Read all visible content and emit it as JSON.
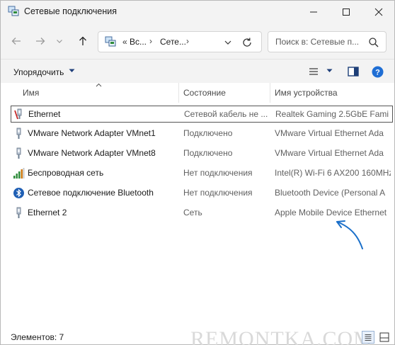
{
  "window": {
    "title": "Сетевые подключения"
  },
  "address_bar": {
    "overflow": "«",
    "crumbs": [
      "Вс...",
      "Сете..."
    ],
    "separator": "›"
  },
  "search": {
    "placeholder": "Поиск в: Сетевые п..."
  },
  "toolbar": {
    "organize_label": "Упорядочить"
  },
  "columns": {
    "name": "Имя",
    "status": "Состояние",
    "device": "Имя устройства"
  },
  "connections": [
    {
      "name": "Ethernet",
      "status": "Сетевой кабель не ...",
      "device": "Realtek Gaming 2.5GbE Fami",
      "icon": "ethernet-disconnected-icon"
    },
    {
      "name": "VMware Network Adapter VMnet1",
      "status": "Подключено",
      "device": "VMware Virtual Ethernet Ada",
      "icon": "ethernet-icon"
    },
    {
      "name": "VMware Network Adapter VMnet8",
      "status": "Подключено",
      "device": "VMware Virtual Ethernet Ada",
      "icon": "ethernet-icon"
    },
    {
      "name": "Беспроводная сеть",
      "status": "Нет подключения",
      "device": "Intel(R) Wi-Fi 6 AX200 160MHz",
      "icon": "wifi-signal-icon"
    },
    {
      "name": "Сетевое подключение Bluetooth",
      "status": "Нет подключения",
      "device": "Bluetooth Device (Personal A",
      "icon": "bluetooth-icon"
    },
    {
      "name": "Ethernet 2",
      "status": "Сеть",
      "device": "Apple Mobile Device Ethernet",
      "icon": "ethernet-icon"
    }
  ],
  "statusbar": {
    "count": "Элементов: 7",
    "watermark": "REMONTKA.COM"
  },
  "colors": {
    "accent": "#0067c0",
    "annotation_arrow": "#1a6fc9"
  }
}
